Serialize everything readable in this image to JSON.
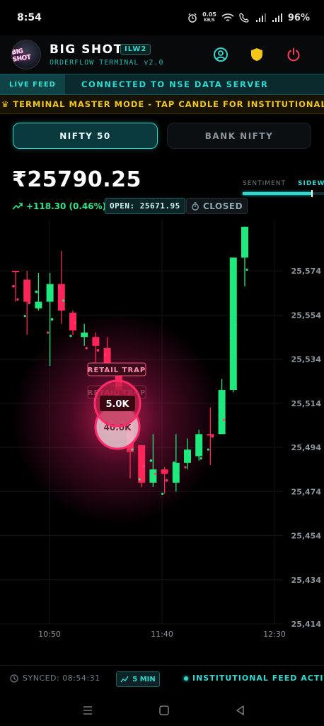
{
  "status_bar": {
    "time": "8:54",
    "net_speed_value": "0.05",
    "net_speed_unit": "KB/S",
    "battery": "96%"
  },
  "header": {
    "logo_text": "BIG SHOT",
    "title": "BIG SHOT",
    "badge": "ILW2",
    "subtitle": "ORDERFLOW TERMINAL v2.0",
    "icons": [
      "user-circle-icon",
      "shield-icon",
      "power-icon"
    ]
  },
  "connection": {
    "live_label": "LIVE FEED",
    "status_text": "CONNECTED  TO NSE DATA SERVER"
  },
  "master_mode": {
    "icon": "crown-icon",
    "text": "TERMINAL MASTER MODE - TAP CANDLE FOR INSTITUTIONAL FLOW"
  },
  "tabs": [
    {
      "label": "NIFTY 50",
      "active": true
    },
    {
      "label": "BANK NIFTY",
      "active": false
    }
  ],
  "quote": {
    "price": "₹25790.25",
    "change": "+118.30 (0.46%)",
    "open": "OPEN: 25671.95",
    "market_status": "CLOSED"
  },
  "sentiment": {
    "label": "SENTIMENT",
    "value": "SIDEWA",
    "level": 0.85
  },
  "chart_data": {
    "type": "candlestick",
    "y_ticks": [
      "25,574",
      "25,554",
      "25,534",
      "25,514",
      "25,494",
      "25,474",
      "25,454",
      "25,434",
      "25,414"
    ],
    "x_ticks": [
      "10:50",
      "11:40",
      "12:30"
    ],
    "ylim": [
      25414,
      25574
    ],
    "candles": [
      {
        "o": 25574,
        "h": 25574,
        "l": 25560,
        "c": 25574,
        "up": false
      },
      {
        "o": 25570,
        "h": 25574,
        "l": 25545,
        "c": 25560,
        "up": false
      },
      {
        "o": 25557,
        "h": 25573,
        "l": 25556,
        "c": 25560,
        "up": true
      },
      {
        "o": 25560,
        "h": 25573,
        "l": 25531,
        "c": 25568,
        "up": true
      },
      {
        "o": 25568,
        "h": 25583,
        "l": 25550,
        "c": 25556,
        "up": false
      },
      {
        "o": 25555,
        "h": 25556,
        "l": 25545,
        "c": 25547,
        "up": false
      },
      {
        "o": 25546,
        "h": 25550,
        "l": 25540,
        "c": 25544,
        "up": true
      },
      {
        "o": 25544,
        "h": 25546,
        "l": 25530,
        "c": 25540,
        "up": false
      },
      {
        "o": 25539,
        "h": 25544,
        "l": 25528,
        "c": 25531,
        "up": false
      },
      {
        "o": 25530,
        "h": 25531,
        "l": 25516,
        "c": 25520,
        "up": false
      },
      {
        "o": 25518,
        "h": 25518,
        "l": 25480,
        "c": 25492,
        "up": false
      },
      {
        "o": 25495,
        "h": 25495,
        "l": 25476,
        "c": 25478,
        "up": false
      },
      {
        "o": 25478,
        "h": 25500,
        "l": 25476,
        "c": 25484,
        "up": true
      },
      {
        "o": 25484,
        "h": 25485,
        "l": 25473,
        "c": 25482,
        "up": false
      },
      {
        "o": 25478,
        "h": 25500,
        "l": 25474,
        "c": 25487,
        "up": true
      },
      {
        "o": 25487,
        "h": 25498,
        "l": 25484,
        "c": 25493,
        "up": true
      },
      {
        "o": 25490,
        "h": 25502,
        "l": 25488,
        "c": 25500,
        "up": true
      },
      {
        "o": 25500,
        "h": 25512,
        "l": 25486,
        "c": 25500,
        "up": false
      },
      {
        "o": 25500,
        "h": 25525,
        "l": 25500,
        "c": 25520,
        "up": true
      },
      {
        "o": 25520,
        "h": 25580,
        "l": 25519,
        "c": 25580,
        "up": true
      },
      {
        "o": 25580,
        "h": 25594,
        "l": 25567,
        "c": 25594,
        "up": true
      }
    ],
    "annotations": [
      "RETAIL TRAP",
      "RETAIL TRAP"
    ],
    "bubbles": [
      "5.0K",
      "40.0K"
    ]
  },
  "footer": {
    "synced": "SYNCED: 08:54:31",
    "timeframe": "5 MIN",
    "feed": "INSTITUTIONAL FEED ACTIVE"
  },
  "navbar": {
    "buttons": [
      "menu-icon",
      "home-icon",
      "back-icon"
    ]
  }
}
